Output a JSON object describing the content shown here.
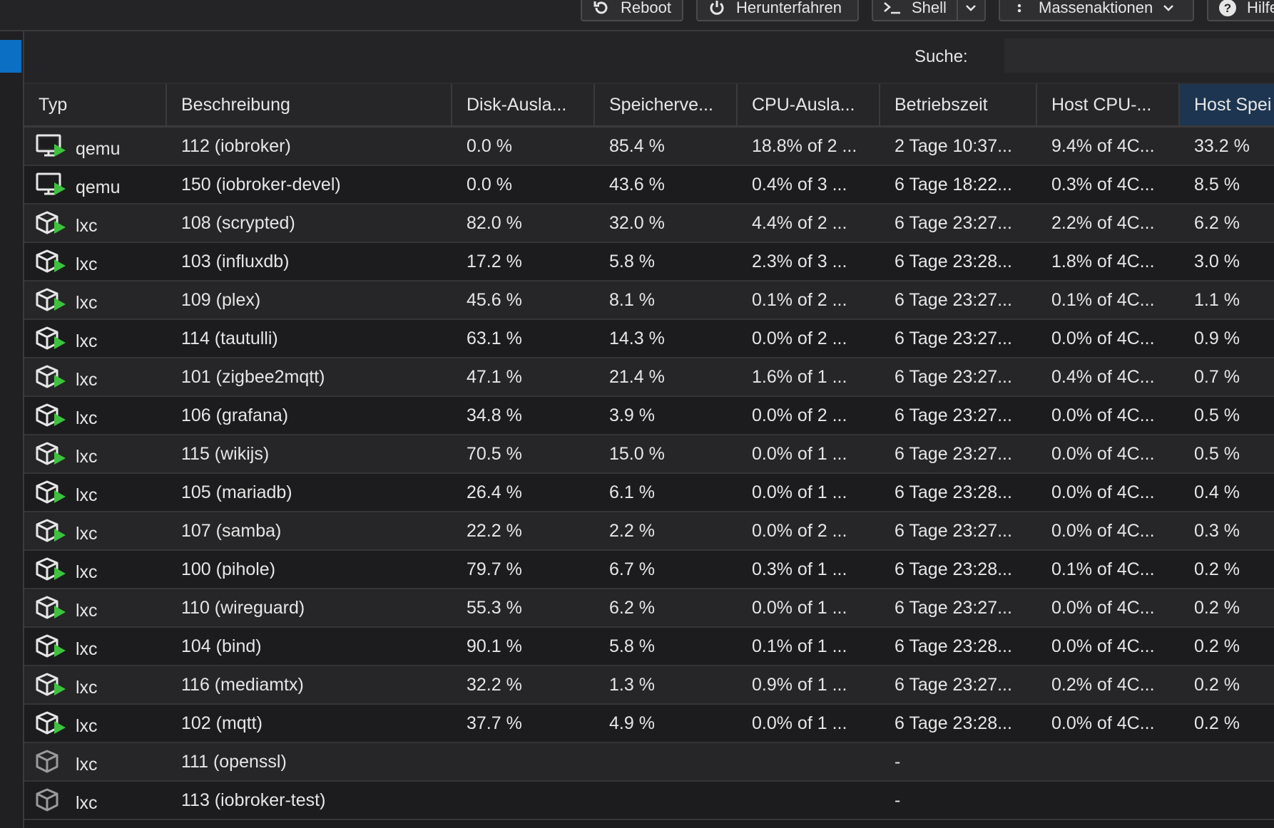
{
  "toolbar": {
    "reboot": "Reboot",
    "shutdown": "Herunterfahren",
    "shell": "Shell",
    "bulk": "Massenaktionen",
    "help": "Hilfe"
  },
  "search": {
    "label": "Suche:",
    "value": "",
    "placeholder": ""
  },
  "columns": [
    "Typ",
    "Beschreibung",
    "Disk-Ausla...",
    "Speicherve...",
    "CPU-Ausla...",
    "Betriebszeit",
    "Host CPU-...",
    "Host Spei"
  ],
  "rows": [
    {
      "type": "qemu",
      "running": true,
      "desc": "112 (iobroker)",
      "disk": "0.0 %",
      "mem": "85.4 %",
      "cpu": "18.8% of 2 ...",
      "uptime": "2 Tage 10:37...",
      "hostcpu": "9.4% of 4C...",
      "hostmem": "33.2 %"
    },
    {
      "type": "qemu",
      "running": true,
      "desc": "150 (iobroker-devel)",
      "disk": "0.0 %",
      "mem": "43.6 %",
      "cpu": "0.4% of 3 ...",
      "uptime": "6 Tage 18:22...",
      "hostcpu": "0.3% of 4C...",
      "hostmem": "8.5 %"
    },
    {
      "type": "lxc",
      "running": true,
      "desc": "108 (scrypted)",
      "disk": "82.0 %",
      "mem": "32.0 %",
      "cpu": "4.4% of 2 ...",
      "uptime": "6 Tage 23:27...",
      "hostcpu": "2.2% of 4C...",
      "hostmem": "6.2 %"
    },
    {
      "type": "lxc",
      "running": true,
      "desc": "103 (influxdb)",
      "disk": "17.2 %",
      "mem": "5.8 %",
      "cpu": "2.3% of 3 ...",
      "uptime": "6 Tage 23:28...",
      "hostcpu": "1.8% of 4C...",
      "hostmem": "3.0 %"
    },
    {
      "type": "lxc",
      "running": true,
      "desc": "109 (plex)",
      "disk": "45.6 %",
      "mem": "8.1 %",
      "cpu": "0.1% of 2 ...",
      "uptime": "6 Tage 23:27...",
      "hostcpu": "0.1% of 4C...",
      "hostmem": "1.1 %"
    },
    {
      "type": "lxc",
      "running": true,
      "desc": "114 (tautulli)",
      "disk": "63.1 %",
      "mem": "14.3 %",
      "cpu": "0.0% of 2 ...",
      "uptime": "6 Tage 23:27...",
      "hostcpu": "0.0% of 4C...",
      "hostmem": "0.9 %"
    },
    {
      "type": "lxc",
      "running": true,
      "desc": "101 (zigbee2mqtt)",
      "disk": "47.1 %",
      "mem": "21.4 %",
      "cpu": "1.6% of 1 ...",
      "uptime": "6 Tage 23:27...",
      "hostcpu": "0.4% of 4C...",
      "hostmem": "0.7 %"
    },
    {
      "type": "lxc",
      "running": true,
      "desc": "106 (grafana)",
      "disk": "34.8 %",
      "mem": "3.9 %",
      "cpu": "0.0% of 2 ...",
      "uptime": "6 Tage 23:27...",
      "hostcpu": "0.0% of 4C...",
      "hostmem": "0.5 %"
    },
    {
      "type": "lxc",
      "running": true,
      "desc": "115 (wikijs)",
      "disk": "70.5 %",
      "mem": "15.0 %",
      "cpu": "0.0% of 1 ...",
      "uptime": "6 Tage 23:27...",
      "hostcpu": "0.0% of 4C...",
      "hostmem": "0.5 %"
    },
    {
      "type": "lxc",
      "running": true,
      "desc": "105 (mariadb)",
      "disk": "26.4 %",
      "mem": "6.1 %",
      "cpu": "0.0% of 1 ...",
      "uptime": "6 Tage 23:28...",
      "hostcpu": "0.0% of 4C...",
      "hostmem": "0.4 %"
    },
    {
      "type": "lxc",
      "running": true,
      "desc": "107 (samba)",
      "disk": "22.2 %",
      "mem": "2.2 %",
      "cpu": "0.0% of 2 ...",
      "uptime": "6 Tage 23:27...",
      "hostcpu": "0.0% of 4C...",
      "hostmem": "0.3 %"
    },
    {
      "type": "lxc",
      "running": true,
      "desc": "100 (pihole)",
      "disk": "79.7 %",
      "mem": "6.7 %",
      "cpu": "0.3% of 1 ...",
      "uptime": "6 Tage 23:28...",
      "hostcpu": "0.1% of 4C...",
      "hostmem": "0.2 %"
    },
    {
      "type": "lxc",
      "running": true,
      "desc": "110 (wireguard)",
      "disk": "55.3 %",
      "mem": "6.2 %",
      "cpu": "0.0% of 1 ...",
      "uptime": "6 Tage 23:27...",
      "hostcpu": "0.0% of 4C...",
      "hostmem": "0.2 %"
    },
    {
      "type": "lxc",
      "running": true,
      "desc": "104 (bind)",
      "disk": "90.1 %",
      "mem": "5.8 %",
      "cpu": "0.1% of 1 ...",
      "uptime": "6 Tage 23:28...",
      "hostcpu": "0.0% of 4C...",
      "hostmem": "0.2 %"
    },
    {
      "type": "lxc",
      "running": true,
      "desc": "116 (mediamtx)",
      "disk": "32.2 %",
      "mem": "1.3 %",
      "cpu": "0.9% of 1 ...",
      "uptime": "6 Tage 23:27...",
      "hostcpu": "0.2% of 4C...",
      "hostmem": "0.2 %"
    },
    {
      "type": "lxc",
      "running": true,
      "desc": "102 (mqtt)",
      "disk": "37.7 %",
      "mem": "4.9 %",
      "cpu": "0.0% of 1 ...",
      "uptime": "6 Tage 23:28...",
      "hostcpu": "0.0% of 4C...",
      "hostmem": "0.2 %"
    },
    {
      "type": "lxc",
      "running": false,
      "desc": "111 (openssl)",
      "disk": "",
      "mem": "",
      "cpu": "",
      "uptime": "-",
      "hostcpu": "",
      "hostmem": ""
    },
    {
      "type": "lxc",
      "running": false,
      "desc": "113 (iobroker-test)",
      "disk": "",
      "mem": "",
      "cpu": "",
      "uptime": "-",
      "hostcpu": "",
      "hostmem": ""
    }
  ],
  "colors": {
    "accent": "#0b6fc4",
    "running": "#3ec23e",
    "active_header": "#1d3550"
  }
}
